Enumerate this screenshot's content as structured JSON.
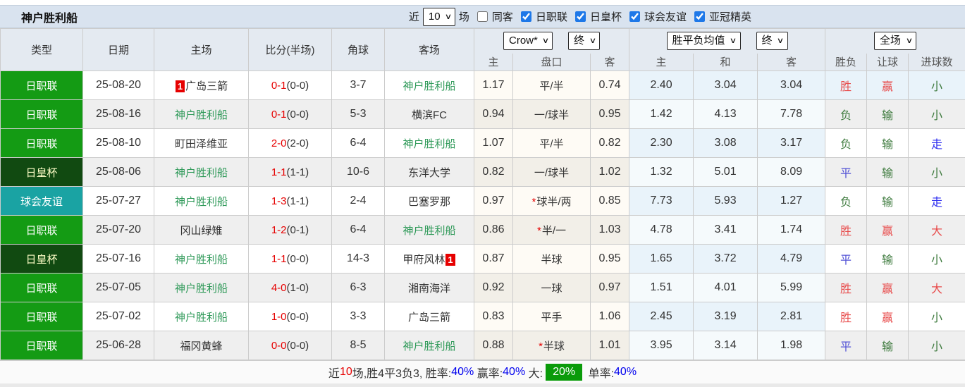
{
  "title": "神户胜利船",
  "controls": {
    "recent_label": "近",
    "recent_value": "10",
    "matches_label": "场",
    "same_away_label": "同客",
    "same_away_checked": false,
    "leagues": [
      {
        "label": "日职联",
        "checked": true
      },
      {
        "label": "日皇杯",
        "checked": true
      },
      {
        "label": "球会友谊",
        "checked": true
      },
      {
        "label": "亚冠精英",
        "checked": true
      }
    ]
  },
  "header": {
    "cols": [
      "类型",
      "日期",
      "主场",
      "比分(半场)",
      "角球",
      "客场"
    ],
    "odds_source_select": "Crow*",
    "odds_stage_select": "终",
    "mean_source_select": "胜平负均值",
    "mean_stage_select": "终",
    "scope_select": "全场",
    "sub_cols": [
      "主",
      "盘口",
      "客",
      "主",
      "和",
      "客",
      "胜负",
      "让球",
      "进球数"
    ]
  },
  "league_styles": {
    "日职联": {
      "bg": "#149b14",
      "fg": "#ffffff"
    },
    "日皇杯": {
      "bg": "#114a11",
      "fg": "#ffffc8"
    },
    "球会友谊": {
      "bg": "#1aa3a3",
      "fg": "#ffffff"
    }
  },
  "result_colors": {
    "win": "#e84c4c",
    "lose": "#3d7a3d",
    "draw": "#5252d6",
    "high": "#e84c4c",
    "low": "#3d7a3d",
    "void": "#2e2ef0"
  },
  "rows": [
    {
      "type": "日职联",
      "date": "25-08-20",
      "home": {
        "badge": "1",
        "name": "广岛三箭",
        "kobe": false
      },
      "ft": "0-1",
      "ht": "(0-0)",
      "corner": "3-7",
      "away": {
        "name": "神户胜利船",
        "kobe": true
      },
      "o1": "1.17",
      "star": false,
      "hcap": "平/半",
      "o2": "0.74",
      "m1": "2.40",
      "m2": "3.04",
      "m3": "3.04",
      "res": {
        "t": "胜",
        "k": "win"
      },
      "ah": {
        "t": "赢",
        "k": "win"
      },
      "ou": {
        "t": "小",
        "k": "low"
      }
    },
    {
      "type": "日职联",
      "date": "25-08-16",
      "home": {
        "name": "神户胜利船",
        "kobe": true
      },
      "ft": "0-1",
      "ht": "(0-0)",
      "corner": "5-3",
      "away": {
        "name": "横滨FC",
        "kobe": false
      },
      "o1": "0.94",
      "star": false,
      "hcap": "一/球半",
      "o2": "0.95",
      "m1": "1.42",
      "m2": "4.13",
      "m3": "7.78",
      "res": {
        "t": "负",
        "k": "lose"
      },
      "ah": {
        "t": "输",
        "k": "lose"
      },
      "ou": {
        "t": "小",
        "k": "low"
      }
    },
    {
      "type": "日职联",
      "date": "25-08-10",
      "home": {
        "name": "町田泽维亚",
        "kobe": false
      },
      "ft": "2-0",
      "ht": "(2-0)",
      "corner": "6-4",
      "away": {
        "name": "神户胜利船",
        "kobe": true
      },
      "o1": "1.07",
      "star": false,
      "hcap": "平/半",
      "o2": "0.82",
      "m1": "2.30",
      "m2": "3.08",
      "m3": "3.17",
      "res": {
        "t": "负",
        "k": "lose"
      },
      "ah": {
        "t": "输",
        "k": "lose"
      },
      "ou": {
        "t": "走",
        "k": "void"
      }
    },
    {
      "type": "日皇杯",
      "date": "25-08-06",
      "home": {
        "name": "神户胜利船",
        "kobe": true
      },
      "ft": "1-1",
      "ht": "(1-1)",
      "corner": "10-6",
      "away": {
        "name": "东洋大学",
        "kobe": false
      },
      "o1": "0.82",
      "star": false,
      "hcap": "一/球半",
      "o2": "1.02",
      "m1": "1.32",
      "m2": "5.01",
      "m3": "8.09",
      "res": {
        "t": "平",
        "k": "draw"
      },
      "ah": {
        "t": "输",
        "k": "lose"
      },
      "ou": {
        "t": "小",
        "k": "low"
      }
    },
    {
      "type": "球会友谊",
      "date": "25-07-27",
      "home": {
        "name": "神户胜利船",
        "kobe": true
      },
      "ft": "1-3",
      "ht": "(1-1)",
      "corner": "2-4",
      "away": {
        "name": "巴塞罗那",
        "kobe": false
      },
      "o1": "0.97",
      "star": true,
      "hcap": "球半/两",
      "o2": "0.85",
      "m1": "7.73",
      "m2": "5.93",
      "m3": "1.27",
      "res": {
        "t": "负",
        "k": "lose"
      },
      "ah": {
        "t": "输",
        "k": "lose"
      },
      "ou": {
        "t": "走",
        "k": "void"
      }
    },
    {
      "type": "日职联",
      "date": "25-07-20",
      "home": {
        "name": "冈山绿雉",
        "kobe": false
      },
      "ft": "1-2",
      "ht": "(0-1)",
      "corner": "6-4",
      "away": {
        "name": "神户胜利船",
        "kobe": true
      },
      "o1": "0.86",
      "star": true,
      "hcap": "半/一",
      "o2": "1.03",
      "m1": "4.78",
      "m2": "3.41",
      "m3": "1.74",
      "res": {
        "t": "胜",
        "k": "win"
      },
      "ah": {
        "t": "赢",
        "k": "win"
      },
      "ou": {
        "t": "大",
        "k": "high"
      }
    },
    {
      "type": "日皇杯",
      "date": "25-07-16",
      "home": {
        "name": "神户胜利船",
        "kobe": true
      },
      "ft": "1-1",
      "ht": "(0-0)",
      "corner": "14-3",
      "away": {
        "name": "甲府风林",
        "kobe": false,
        "badge": "1"
      },
      "o1": "0.87",
      "star": false,
      "hcap": "半球",
      "o2": "0.95",
      "m1": "1.65",
      "m2": "3.72",
      "m3": "4.79",
      "res": {
        "t": "平",
        "k": "draw"
      },
      "ah": {
        "t": "输",
        "k": "lose"
      },
      "ou": {
        "t": "小",
        "k": "low"
      }
    },
    {
      "type": "日职联",
      "date": "25-07-05",
      "home": {
        "name": "神户胜利船",
        "kobe": true
      },
      "ft": "4-0",
      "ht": "(1-0)",
      "corner": "6-3",
      "away": {
        "name": "湘南海洋",
        "kobe": false
      },
      "o1": "0.92",
      "star": false,
      "hcap": "一球",
      "o2": "0.97",
      "m1": "1.51",
      "m2": "4.01",
      "m3": "5.99",
      "res": {
        "t": "胜",
        "k": "win"
      },
      "ah": {
        "t": "赢",
        "k": "win"
      },
      "ou": {
        "t": "大",
        "k": "high"
      }
    },
    {
      "type": "日职联",
      "date": "25-07-02",
      "home": {
        "name": "神户胜利船",
        "kobe": true
      },
      "ft": "1-0",
      "ht": "(0-0)",
      "corner": "3-3",
      "away": {
        "name": "广岛三箭",
        "kobe": false
      },
      "o1": "0.83",
      "star": false,
      "hcap": "平手",
      "o2": "1.06",
      "m1": "2.45",
      "m2": "3.19",
      "m3": "2.81",
      "res": {
        "t": "胜",
        "k": "win"
      },
      "ah": {
        "t": "赢",
        "k": "win"
      },
      "ou": {
        "t": "小",
        "k": "low"
      }
    },
    {
      "type": "日职联",
      "date": "25-06-28",
      "home": {
        "name": "福冈黄蜂",
        "kobe": false
      },
      "ft": "0-0",
      "ht": "(0-0)",
      "corner": "8-5",
      "away": {
        "name": "神户胜利船",
        "kobe": true
      },
      "o1": "0.88",
      "star": true,
      "hcap": "半球",
      "o2": "1.01",
      "m1": "3.95",
      "m2": "3.14",
      "m3": "1.98",
      "res": {
        "t": "平",
        "k": "draw"
      },
      "ah": {
        "t": "输",
        "k": "lose"
      },
      "ou": {
        "t": "小",
        "k": "low"
      }
    }
  ],
  "footer": {
    "prefix": "近",
    "count": "10",
    "stats": "场,胜4平3负3, 胜率:",
    "win_rate": "40%",
    "ah_label": " 赢率:",
    "ah_rate": "40%",
    "ou_label": " 大:",
    "ou_rate": "20%",
    "single_label": " 单率:",
    "single_rate": "40%"
  }
}
